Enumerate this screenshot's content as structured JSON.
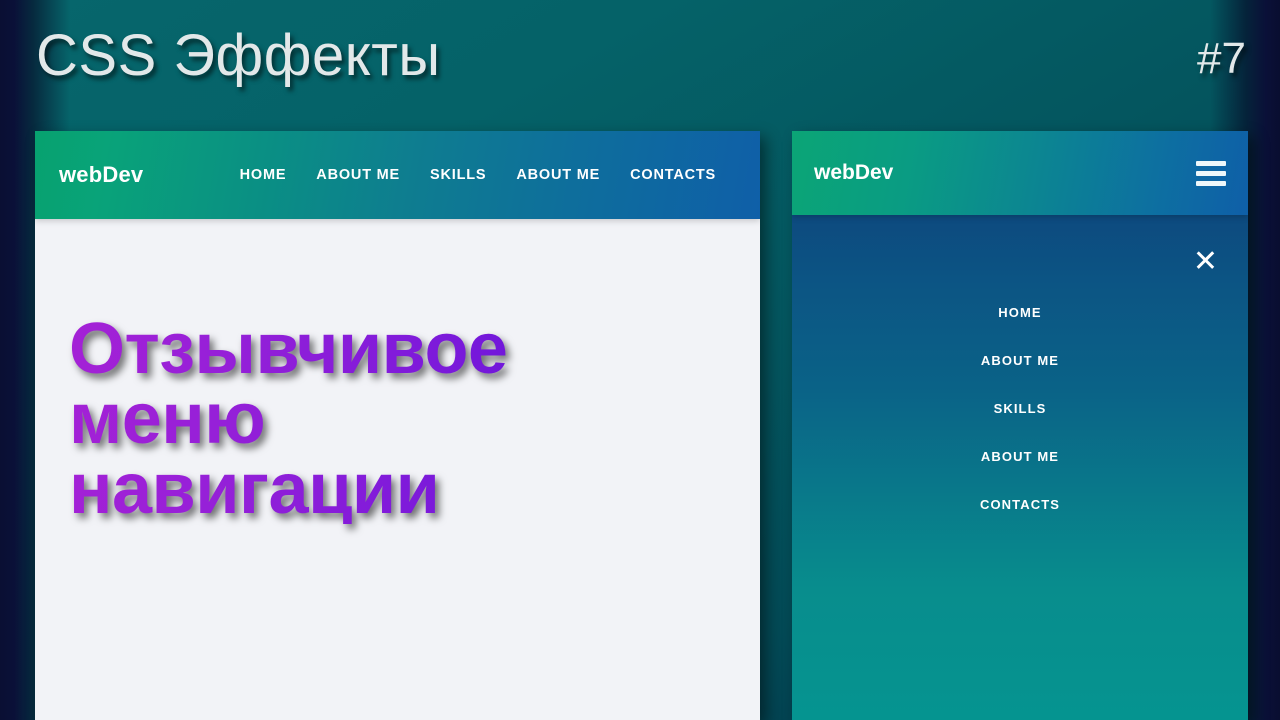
{
  "video": {
    "title": "CSS Эффекты",
    "episode": "#7"
  },
  "desktop_panel": {
    "navbar": {
      "logo": "webDev",
      "links": [
        {
          "label": "HOME"
        },
        {
          "label": "ABOUT ME"
        },
        {
          "label": "SKILLS"
        },
        {
          "label": "ABOUT ME"
        },
        {
          "label": "CONTACTS"
        }
      ]
    },
    "hero": {
      "heading": "Отзывчивое\nменю\nнавигации",
      "heading_gradient_from": "#a421d6",
      "heading_gradient_to": "#5410d8",
      "background": "#f2f3f7"
    }
  },
  "mobile_panel": {
    "navbar": {
      "logo": "webDev",
      "menu_icon": "hamburger-icon"
    },
    "overlay": {
      "close_icon": "✕",
      "links": [
        {
          "label": "HOME"
        },
        {
          "label": "ABOUT ME"
        },
        {
          "label": "SKILLS"
        },
        {
          "label": "ABOUT ME"
        },
        {
          "label": "CONTACTS"
        }
      ]
    }
  },
  "theme": {
    "page_bg_teal": "#056268",
    "page_bg_navy": "#0a1038",
    "navbar_gradient_from": "#07a26f",
    "navbar_gradient_to": "#0f5fa8",
    "overlay_gradient_from": "#0d4a7f",
    "overlay_gradient_to": "#059490",
    "title_color": "#e2e8e9"
  }
}
